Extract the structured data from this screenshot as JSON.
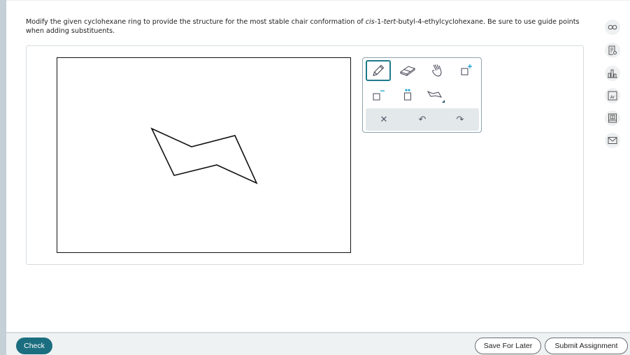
{
  "question": {
    "prompt_before": "Modify the given cyclohexane ring to provide the structure for the most stable chair conformation of ",
    "prompt_italic_1": "cis",
    "prompt_mid_1": "-1-",
    "prompt_italic_2": "tert",
    "prompt_after": "-butyl-4-ethylcyclohexane. Be sure to use guide points when adding substituents."
  },
  "toolbar": {
    "tools": [
      {
        "name": "draw-tool",
        "icon": "pencil-icon",
        "active": true
      },
      {
        "name": "erase-tool",
        "icon": "eraser-icon",
        "active": false
      },
      {
        "name": "move-tool",
        "icon": "hand-icon",
        "active": false
      },
      {
        "name": "add-positive-charge-tool",
        "icon": "positive-charge-icon",
        "active": false
      },
      {
        "name": "add-negative-charge-tool",
        "icon": "negative-charge-icon",
        "active": false
      },
      {
        "name": "add-lone-pair-tool",
        "icon": "lone-pair-icon",
        "active": false
      },
      {
        "name": "templates-tool",
        "icon": "chair-template-icon",
        "active": false
      }
    ],
    "actions": [
      {
        "name": "clear",
        "icon": "close-icon",
        "glyph": "✕"
      },
      {
        "name": "undo",
        "icon": "undo-icon",
        "glyph": "↶"
      },
      {
        "name": "redo",
        "icon": "redo-icon",
        "glyph": "↷"
      }
    ],
    "accent_color": "#1f7a8c",
    "charge_color": "#2aa6d8"
  },
  "sidebar": {
    "buttons": [
      {
        "name": "view-full-question-button",
        "icon": "glasses-icon"
      },
      {
        "name": "hint-button",
        "icon": "hint-document-icon"
      },
      {
        "name": "results-button",
        "icon": "bar-chart-icon"
      },
      {
        "name": "periodic-table-button",
        "icon": "periodic-element-icon",
        "label": "Ar"
      },
      {
        "name": "ebook-button",
        "icon": "book-icon"
      },
      {
        "name": "message-button",
        "icon": "envelope-icon"
      }
    ]
  },
  "footer": {
    "check_label": "Check",
    "save_label": "Save For Later",
    "submit_label": "Submit Assignment",
    "check_color": "#1b6e7f"
  }
}
